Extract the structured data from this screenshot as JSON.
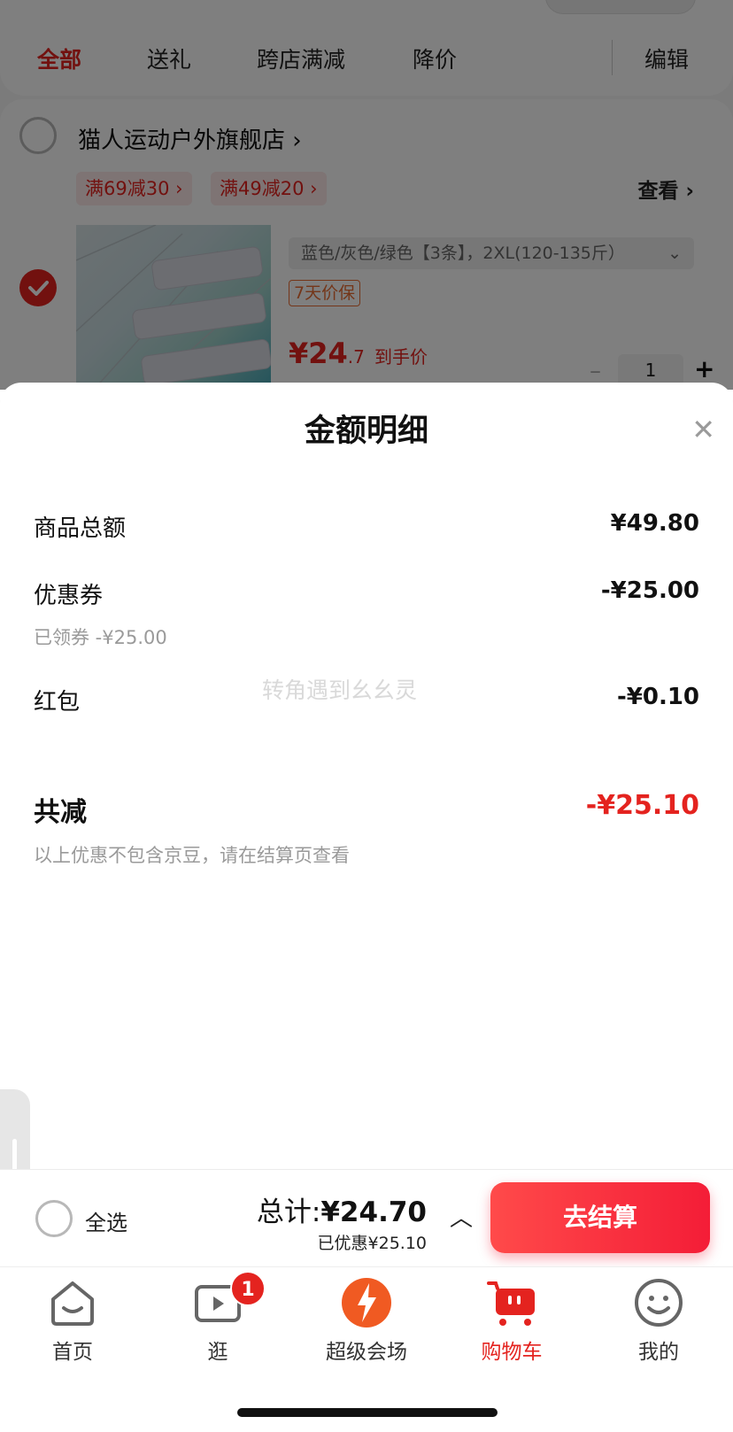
{
  "tabs": {
    "all": "全部",
    "gift": "送礼",
    "cross_store": "跨店满减",
    "price_drop": "降价",
    "edit": "编辑"
  },
  "shop": {
    "name": "猫人运动户外旗舰店",
    "coupons": [
      "满69减30 ›",
      "满49减20 ›"
    ],
    "view_label": "查看 ›",
    "product": {
      "sku": "蓝色/灰色/绿色【3条】，2XL(120-135斤）",
      "guarantee": "7天价保",
      "price_int": "¥24",
      "price_dec": ".7",
      "price_note": "到手价",
      "qty": "1"
    }
  },
  "sheet": {
    "title": "金额明细",
    "watermark": "转角遇到幺幺灵",
    "rows": [
      {
        "label": "商品总额",
        "value": "¥49.80"
      },
      {
        "label": "优惠券",
        "value": "-¥25.00",
        "note": "已领券 -¥25.00"
      },
      {
        "label": "红包",
        "value": "-¥0.10"
      }
    ],
    "total": {
      "label": "共减",
      "value": "-¥25.10",
      "note": "以上优惠不包含京豆，请在结算页查看"
    }
  },
  "settle": {
    "select_all": "全选",
    "total_prefix": "总计:",
    "total_value": "¥24.70",
    "saved": "已优惠¥25.10",
    "checkout": "去结算"
  },
  "nav": [
    {
      "label": "首页",
      "icon": "home-icon"
    },
    {
      "label": "逛",
      "icon": "video-icon",
      "badge": "1"
    },
    {
      "label": "超级会场",
      "icon": "super-venue-icon"
    },
    {
      "label": "购物车",
      "icon": "cart-icon"
    },
    {
      "label": "我的",
      "icon": "profile-icon"
    }
  ],
  "colors": {
    "accent": "#e4231f"
  }
}
